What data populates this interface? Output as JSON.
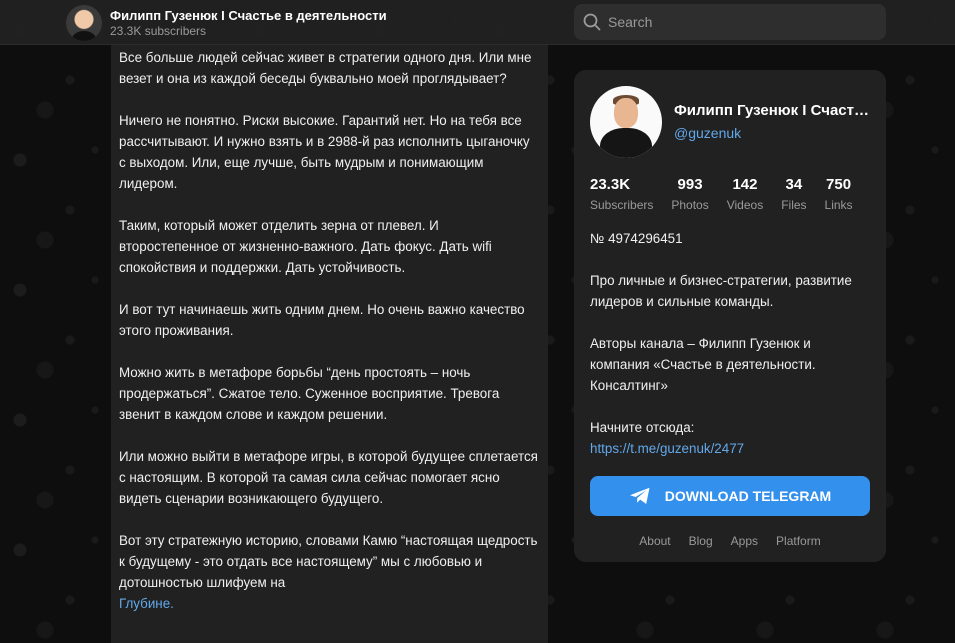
{
  "header": {
    "channel_title": "Филипп Гузенюк I Счастье в деятельности",
    "subscribers": "23.3K subscribers",
    "search_placeholder": "Search"
  },
  "post": {
    "paragraphs": [
      "Все больше людей сейчас живет в стратегии одного дня. Или мне везет и она из каждой беседы буквально моей проглядывает?",
      "Ничего не понятно. Риски высокие. Гарантий нет. Но на тебя все рассчитывают. И нужно взять и в 2988-й раз исполнить цыганочку с выходом. Или, еще лучше, быть мудрым и понимающим лидером.",
      "Таким, который может отделить зерна от плевел. И второстепенное от жизненно-важного. Дать фокус. Дать wifi спокойствия и поддержки. Дать устойчивость.",
      "И вот тут начинаешь жить одним днем. Но очень важно качество этого проживания.",
      "Можно жить в метафоре борьбы “день простоять – ночь продержаться”. Сжатое тело. Суженное восприятие. Тревога звенит в каждом слове и каждом решении.",
      "Или можно выйти в метафоре игры, в которой будущее сплетается с настоящим. В которой та самая сила сейчас помогает ясно видеть сценарии возникающего будущего.",
      "Вот эту стратежную историю, словами Камю “настоящая щедрость к будущему - это отдать все настоящему” мы с любовью и дотошностью шлифуем на"
    ],
    "link_text": "Глубине."
  },
  "card": {
    "title": "Филипп Гузенюк I Счастье в деятельности",
    "handle": "@guzenuk",
    "stats": [
      {
        "value": "23.3K",
        "label": "Subscribers"
      },
      {
        "value": "993",
        "label": "Photos"
      },
      {
        "value": "142",
        "label": "Videos"
      },
      {
        "value": "34",
        "label": "Files"
      },
      {
        "value": "750",
        "label": "Links"
      }
    ],
    "number": "№ 4974296451",
    "description": "Про личные и бизнес-стратегии, развитие лидеров и сильные команды.",
    "authors": "Авторы канала – Филипп Гузенюк и компания «Счастье в деятельности. Консалтинг»",
    "start_label": "Начните отсюда:",
    "start_link": "https://t.me/guzenuk/2477",
    "download_label": "DOWNLOAD TELEGRAM"
  },
  "footer": {
    "links": [
      "About",
      "Blog",
      "Apps",
      "Platform"
    ]
  },
  "colors": {
    "accent": "#3390ec",
    "link": "#62a8ea",
    "panel": "#212121"
  }
}
